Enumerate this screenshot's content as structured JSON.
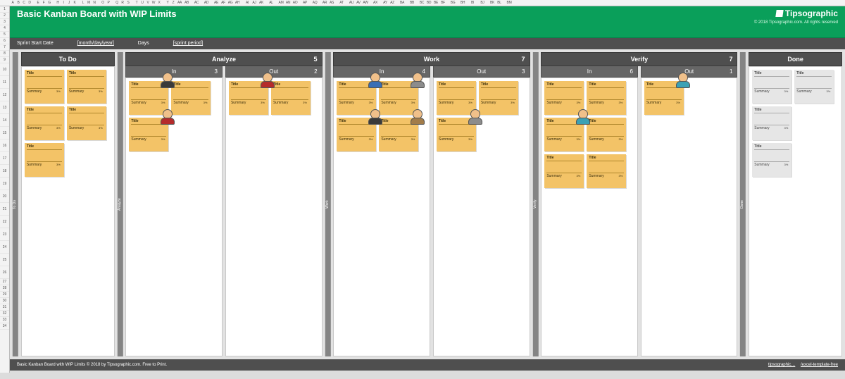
{
  "sheet": {
    "cols": [
      "A",
      "B",
      "C",
      "D",
      "",
      "E",
      "F",
      "G",
      "",
      "H",
      "I",
      "J",
      "K",
      "",
      "L",
      "M",
      "N",
      "",
      "O",
      "P",
      "",
      "Q",
      "R",
      "S",
      "",
      "T",
      "U",
      "V",
      "W",
      "X",
      "",
      "Y",
      "Z",
      "AA",
      "AB",
      "",
      "AC",
      "",
      "AD",
      "",
      "AE",
      "AF",
      "AG",
      "AH",
      "",
      "AI",
      "AJ",
      "AK",
      "",
      "AL",
      "",
      "AM",
      "AN",
      "AO",
      "",
      "AP",
      "",
      "AQ",
      "",
      "AR",
      "AS",
      "",
      "AT",
      "",
      "AU",
      "AV",
      "AW",
      "",
      "AX",
      "",
      "AY",
      "AZ",
      "",
      "BA",
      "",
      "BB",
      "",
      "BC",
      "BD",
      "BE",
      "BF",
      "",
      "BG",
      "",
      "BH",
      "",
      "BI",
      "",
      "BJ",
      "",
      "BK",
      "BL",
      "",
      "BM"
    ],
    "rows": [
      "1",
      "2",
      "3",
      "4",
      "5",
      "6",
      "7",
      "8",
      "9",
      "10",
      "11",
      "12",
      "13",
      "14",
      "15",
      "16",
      "17",
      "18",
      "19",
      "20",
      "21",
      "22",
      "23",
      "24",
      "25",
      "26",
      "27",
      "28",
      "29",
      "30",
      "31",
      "32",
      "33",
      "34"
    ]
  },
  "header": {
    "title": "Basic Kanban Board with WIP Limits",
    "brand": "Tipsographic",
    "copyright": "© 2018 Tipsographic.com. All rights reserved"
  },
  "sprint": {
    "label_start": "Sprint Start Date",
    "value_start": "[month/day/year]",
    "label_days": "Days",
    "value_days": "[sprint period]"
  },
  "lanes": {
    "todo": {
      "label": "To Do",
      "vlabel": "To Do"
    },
    "analyze": {
      "label": "Analyze",
      "wip": "5",
      "vlabel": "Analyze",
      "in": {
        "label": "In",
        "wip": "3"
      },
      "out": {
        "label": "Out",
        "wip": "2"
      }
    },
    "work": {
      "label": "Work",
      "wip": "7",
      "vlabel": "Work",
      "in": {
        "label": "In",
        "wip": "4"
      },
      "out": {
        "label": "Out",
        "wip": "3"
      }
    },
    "verify": {
      "label": "Verify",
      "wip": "7",
      "vlabel": "Verify",
      "in": {
        "label": "In",
        "wip": "6"
      },
      "out": {
        "label": "Out",
        "wip": "1"
      }
    },
    "done": {
      "label": "Done",
      "vlabel": "Done"
    }
  },
  "card": {
    "title": "Title",
    "summary": "Summary",
    "pct": "3%"
  },
  "footer": {
    "text": "Basic Kanban Board with WIP Limits © 2018 by Tipsographic.com. Free to Print.",
    "link1": "tipsographic…",
    "link2": "/excel-template-free"
  },
  "avatar_colors": [
    "#3a3a3a",
    "#b52b2b",
    "#b52b2b",
    "#3a6fb5",
    "#8c8c8c",
    "#3a3a3a",
    "#a27c4a",
    "#8c8c8c",
    "#3aa1b5",
    "#3aa1b5"
  ]
}
